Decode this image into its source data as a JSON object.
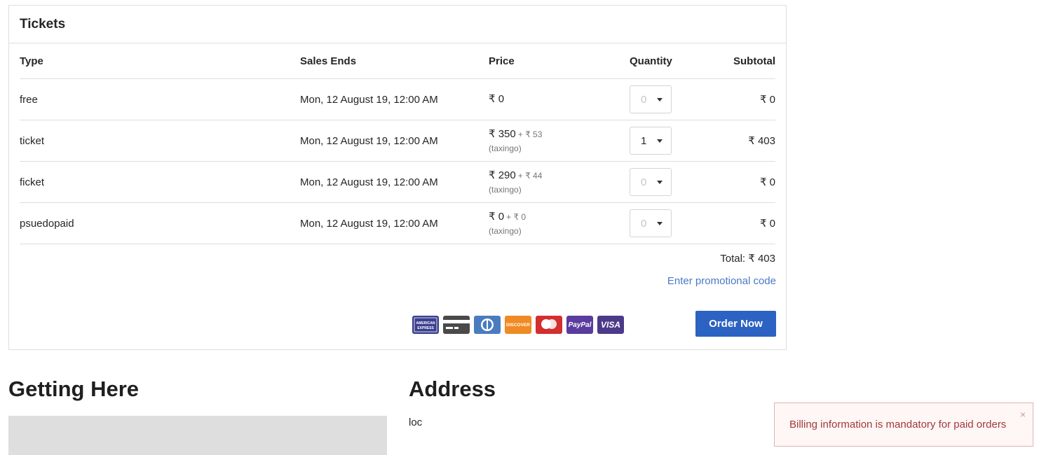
{
  "tickets": {
    "title": "Tickets",
    "columns": {
      "type": "Type",
      "sales_ends": "Sales Ends",
      "price": "Price",
      "quantity": "Quantity",
      "subtotal": "Subtotal"
    },
    "rows": [
      {
        "type": "free",
        "sales_ends": "Mon, 12 August 19, 12:00 AM",
        "price": "₹ 0",
        "tax": "",
        "tax_note": "",
        "quantity": "0",
        "subtotal": "₹ 0"
      },
      {
        "type": "ticket",
        "sales_ends": "Mon, 12 August 19, 12:00 AM",
        "price": "₹ 350",
        "tax": "+ ₹ 53",
        "tax_note": "(taxingo)",
        "quantity": "1",
        "subtotal": "₹ 403"
      },
      {
        "type": "ficket",
        "sales_ends": "Mon, 12 August 19, 12:00 AM",
        "price": "₹ 290",
        "tax": "+ ₹ 44",
        "tax_note": "(taxingo)",
        "quantity": "0",
        "subtotal": "₹ 0"
      },
      {
        "type": "psuedopaid",
        "sales_ends": "Mon, 12 August 19, 12:00 AM",
        "price": "₹ 0",
        "tax": "+ ₹ 0",
        "tax_note": "(taxingo)",
        "quantity": "0",
        "subtotal": "₹ 0"
      }
    ],
    "total": "Total: ₹ 403",
    "promo_link": "Enter promotional code",
    "order_button": "Order Now",
    "payment_cards": [
      {
        "icon": "amex-icon",
        "label": "AMERICAN EXPRESS",
        "color": "#3b3f8f"
      },
      {
        "icon": "credit-card-icon",
        "label": "",
        "color": "#4a4a4a"
      },
      {
        "icon": "diners-club-icon",
        "label": "",
        "color": "#4a7cc0"
      },
      {
        "icon": "discover-icon",
        "label": "DISCOVER",
        "color": "#f08a24"
      },
      {
        "icon": "mastercard-icon",
        "label": "",
        "color": "#d42e2e"
      },
      {
        "icon": "paypal-icon",
        "label": "PayPal",
        "color": "#5a3c9e"
      },
      {
        "icon": "visa-icon",
        "label": "VISA",
        "color": "#4b3a8a"
      }
    ]
  },
  "getting_here": {
    "title": "Getting Here"
  },
  "address": {
    "title": "Address",
    "text": "loc"
  },
  "toast": {
    "message": "Billing information is mandatory for paid orders",
    "close": "×",
    "bg_color": "#fff6f6",
    "text_color": "#9f3a38"
  },
  "accent_color": "#2c62c2"
}
